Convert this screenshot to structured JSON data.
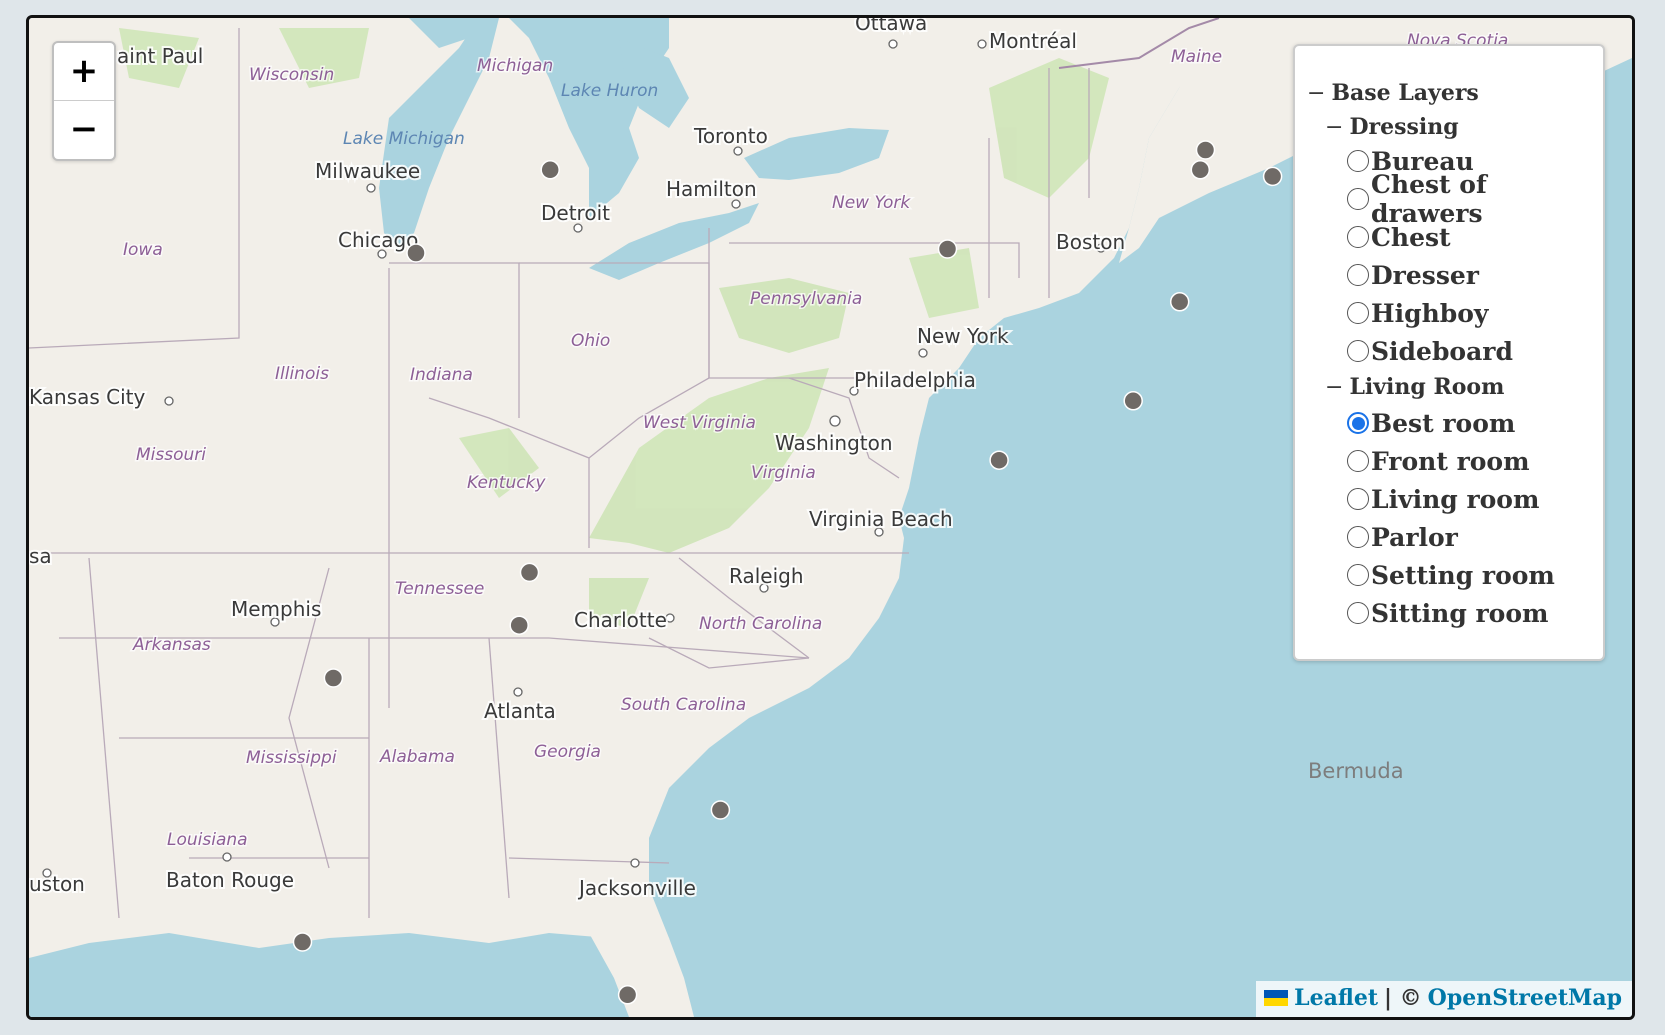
{
  "map": {
    "zoom_in_label": "+",
    "zoom_out_label": "−",
    "cities": [
      "Saint Paul",
      "Milwaukee",
      "Chicago",
      "Detroit",
      "Toronto",
      "Hamilton",
      "Ottawa",
      "Montréal",
      "Boston",
      "New York",
      "Philadelphia",
      "Washington",
      "Virginia Beach",
      "Raleigh",
      "Charlotte",
      "Atlanta",
      "Memphis",
      "Kansas City",
      "Baton Rouge",
      "Jacksonville",
      "Houston",
      "Tulsa"
    ],
    "city_label_text": {
      "saint_paul": "aint Paul",
      "houston": "uston",
      "tulsa": "sa"
    },
    "states": [
      "Wisconsin",
      "Michigan",
      "Iowa",
      "Illinois",
      "Indiana",
      "Ohio",
      "New York",
      "Pennsylvania",
      "Missouri",
      "West Virginia",
      "Kentucky",
      "Virginia",
      "Tennessee",
      "North Carolina",
      "Arkansas",
      "South Carolina",
      "Mississippi",
      "Alabama",
      "Georgia",
      "Louisiana",
      "Maine",
      "Nova Scotia"
    ],
    "water": [
      "Lake Michigan",
      "Lake Huron"
    ],
    "islands": [
      "Bermuda"
    ],
    "marker_color": "#6f6a66",
    "markers": [
      {
        "lat": 44.3,
        "lon": -85.3
      },
      {
        "lat": 43.04,
        "lon": -87.9
      },
      {
        "lat": 43.1,
        "lon": -77.6
      },
      {
        "lat": 44.6,
        "lon": -72.6
      },
      {
        "lat": 44.3,
        "lon": -72.7
      },
      {
        "lat": 44.2,
        "lon": -71.3
      },
      {
        "lat": 42.3,
        "lon": -73.1
      },
      {
        "lat": 40.8,
        "lon": -74.0
      },
      {
        "lat": 39.9,
        "lon": -76.6
      },
      {
        "lat": 38.2,
        "lon": -85.7
      },
      {
        "lat": 37.4,
        "lon": -85.9
      },
      {
        "lat": 36.6,
        "lon": -89.5
      },
      {
        "lat": 34.6,
        "lon": -82.0
      },
      {
        "lat": 32.6,
        "lon": -90.1
      },
      {
        "lat": 31.8,
        "lon": -83.8
      }
    ]
  },
  "layers": {
    "root_label": "Base Layers",
    "groups": [
      {
        "label": "Dressing",
        "items": [
          "Bureau",
          "Chest of drawers",
          "Chest",
          "Dresser",
          "Highboy",
          "Sideboard"
        ]
      },
      {
        "label": "Living Room",
        "items": [
          "Best room",
          "Front room",
          "Living room",
          "Parlor",
          "Setting room",
          "Sitting room"
        ]
      }
    ],
    "selected": "Best room"
  },
  "attribution": {
    "leaflet": "Leaflet",
    "separator": "| ©",
    "osm": "OpenStreetMap"
  }
}
